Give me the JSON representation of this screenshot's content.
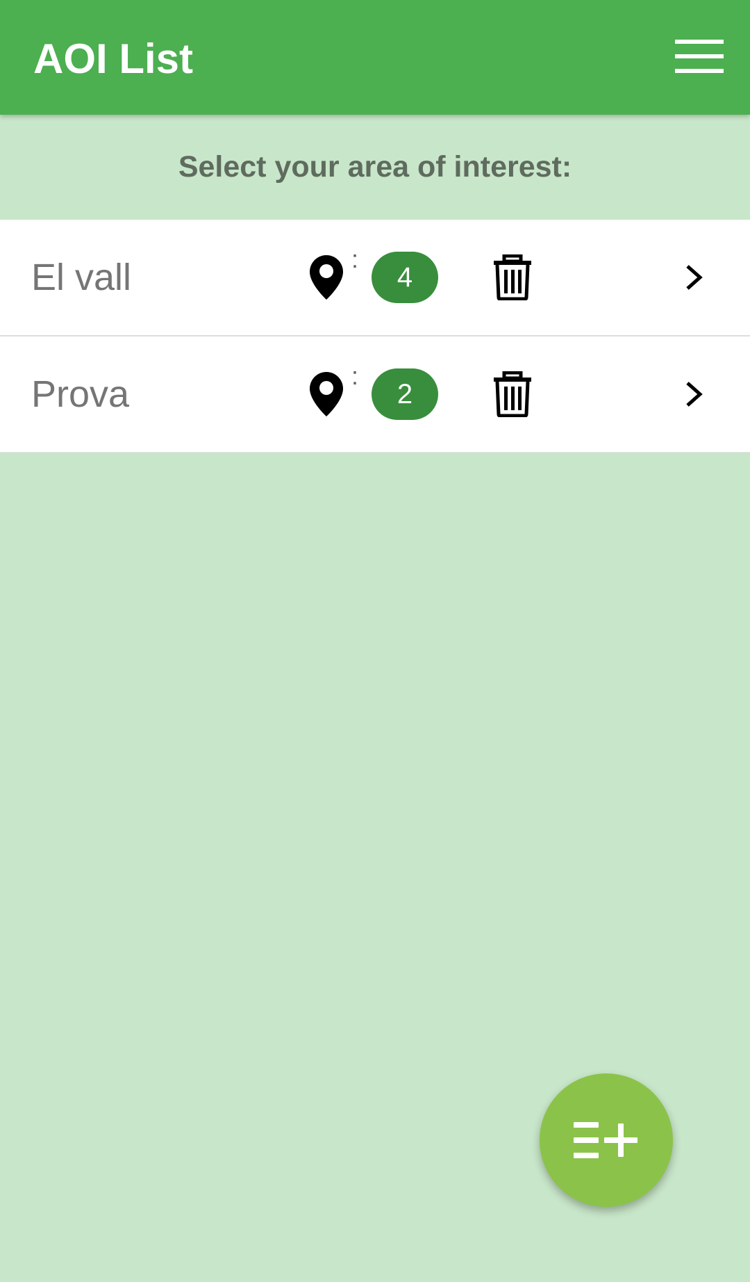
{
  "app_bar": {
    "title": "AOI List",
    "menu_icon": "menu-icon"
  },
  "subtitle": "Select your area of interest:",
  "aoi_items": [
    {
      "name": "El vall",
      "separator": ":",
      "count": "4"
    },
    {
      "name": "Prova",
      "separator": ":",
      "count": "2"
    }
  ],
  "icons": {
    "location": "map-pin-icon",
    "delete": "trash-icon",
    "open": "chevron-right-icon",
    "fab": "add-list-icon"
  },
  "colors": {
    "primary": "#4caf50",
    "background": "#c8e6c9",
    "badge": "#388e3c",
    "fab": "#8bc34a"
  }
}
